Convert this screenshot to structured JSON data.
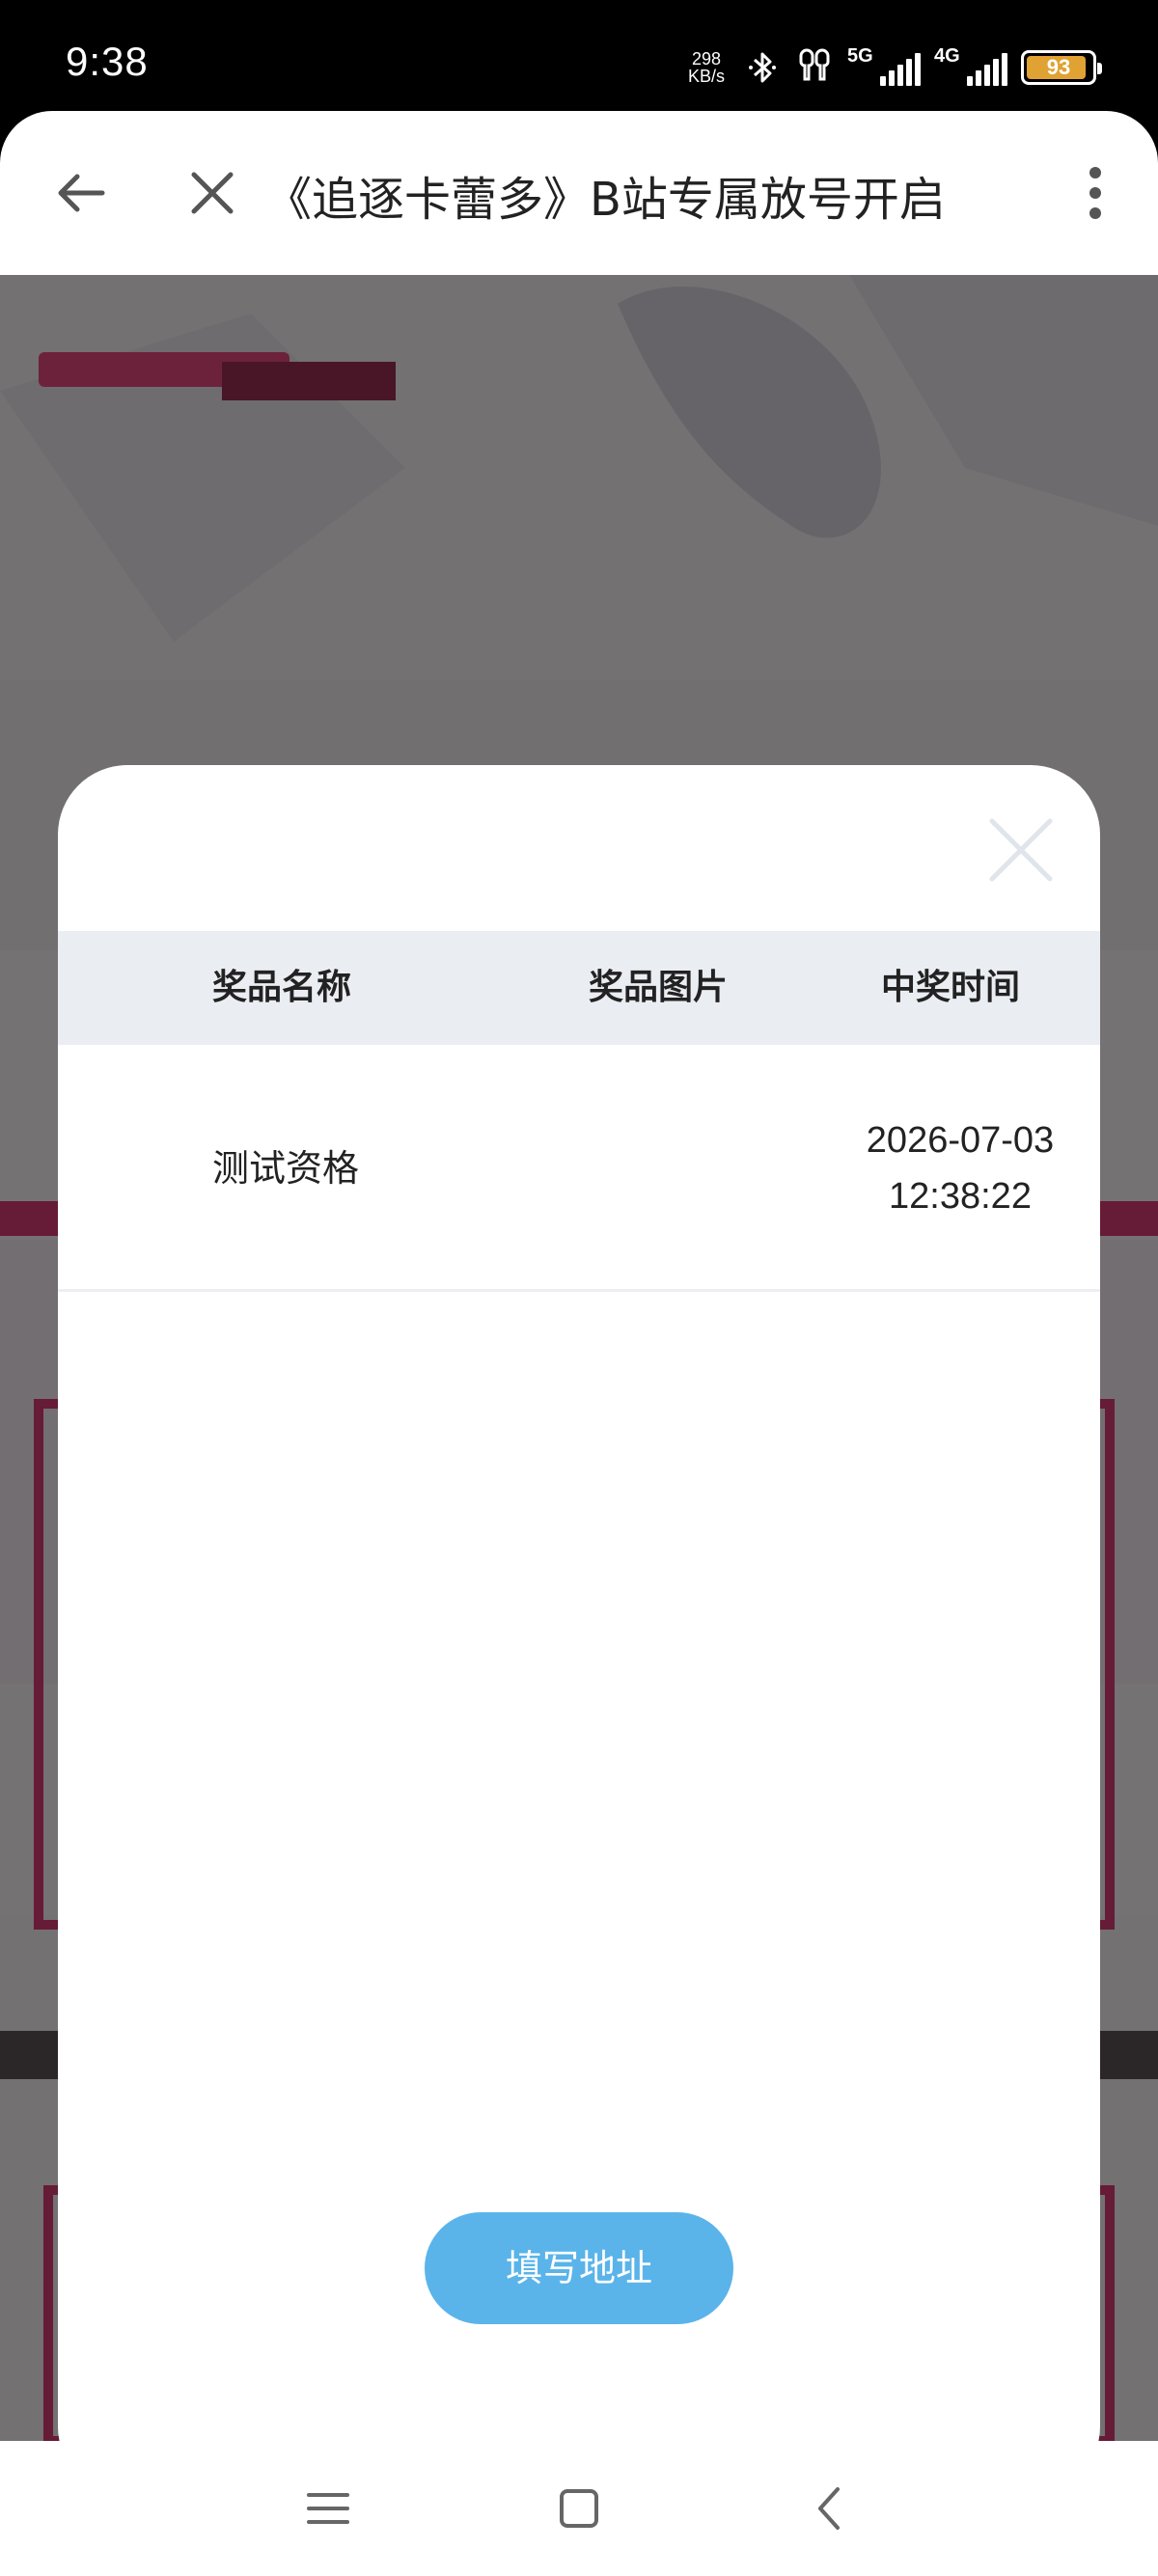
{
  "status_bar": {
    "time": "9:38",
    "net_speed_value": "298",
    "net_speed_unit": "KB/s",
    "signal1_label": "5G",
    "signal2_label": "4G",
    "battery": "93",
    "battery_color": "#e0a233"
  },
  "nav": {
    "title": "《追逐卡蕾多》B站专属放号开启",
    "back_icon": "arrow-left-icon",
    "close_icon": "close-icon",
    "more_icon": "more-vertical-icon"
  },
  "modal": {
    "columns": [
      "奖品名称",
      "奖品图片",
      "中奖时间"
    ],
    "rows": [
      {
        "name": "测试资格",
        "date": "2026-07-03",
        "time": "12:38:22"
      }
    ],
    "button_label": "填写地址",
    "button_color": "#5ab4ea"
  },
  "bottom_nav": {
    "icons": [
      "menu-icon",
      "home-icon",
      "back-icon"
    ]
  }
}
